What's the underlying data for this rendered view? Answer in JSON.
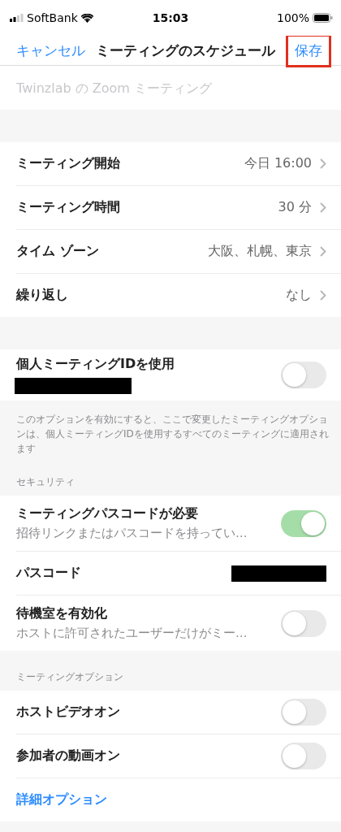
{
  "status_bar": {
    "carrier": "SoftBank",
    "time": "15:03",
    "battery": "100%"
  },
  "nav": {
    "cancel": "キャンセル",
    "title": "ミーティングのスケジュール",
    "save": {
      "label": "保存",
      "highlighted": true
    }
  },
  "topic_field": {
    "placeholder": "Twinzlab の Zoom ミーティング"
  },
  "schedule_rows": [
    {
      "label": "ミーティング開始",
      "value": "今日 16:00"
    },
    {
      "label": "ミーティング時間",
      "value": "30 分"
    },
    {
      "label": "タイム ゾーン",
      "value": "大阪、札幌、東京"
    },
    {
      "label": "繰り返し",
      "value": "なし"
    }
  ],
  "personal_id": {
    "label": "個人ミーティングIDを使用",
    "redacted": true,
    "on": false,
    "note": "このオプションを有効にすると、ここで変更したミーティングオプションは、個人ミーティングIDを使用するすべてのミーティングに適用されます"
  },
  "sections": [
    {
      "header": "セキュリティ",
      "rows": [
        {
          "kind": "toggle",
          "label": "ミーティングパスコードが必要",
          "sub": "招待リンクまたはパスコードを持ってい…",
          "on": true
        },
        {
          "kind": "redacted",
          "label": "パスコード"
        },
        {
          "kind": "toggle",
          "label": "待機室を有効化",
          "sub": "ホストに許可されたユーザーだけがミー…",
          "on": false
        }
      ]
    },
    {
      "header": "ミーティングオプション",
      "rows": [
        {
          "kind": "toggle",
          "label": "ホストビデオオン",
          "on": false
        },
        {
          "kind": "toggle",
          "label": "参加者の動画オン",
          "on": false
        },
        {
          "kind": "link",
          "label": "詳細オプション"
        }
      ]
    }
  ]
}
